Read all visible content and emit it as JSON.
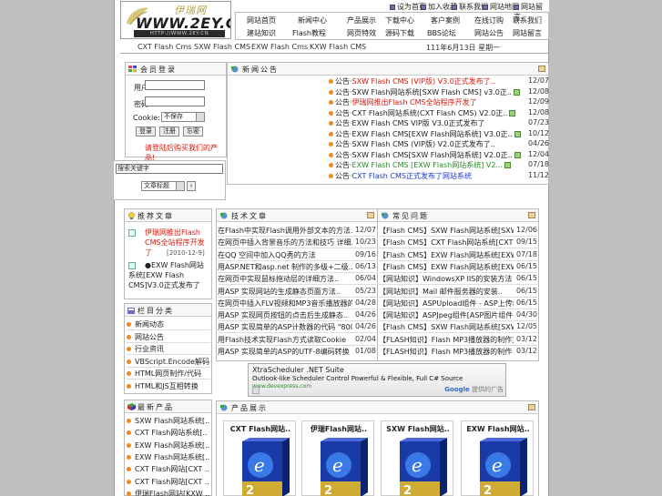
{
  "logo": {
    "cn": "伊瑞网",
    "domain": "WWW.2EY.CN",
    "url": "HTTP://WWW.2EY.CN"
  },
  "topbar": [
    "设为首页",
    "加入收藏",
    "联系我们",
    "网站地图",
    "网站留言"
  ],
  "nav": [
    [
      "网站首页",
      "新闻中心",
      "产品展示",
      "下载中心",
      "客户案例",
      "在线订购",
      "联系我们"
    ],
    [
      "建站知识",
      "Flash教程",
      "网页特效",
      "源码下载",
      "BBS论坛",
      "网站公告",
      "网站留言"
    ]
  ],
  "subnav": {
    "items": [
      "CXT Flash Cms",
      "SXW Flash CMS",
      "EXW Flash Cms",
      "KXW Flash CMS"
    ],
    "date": "111年6月13日 星期一"
  },
  "login": {
    "title": "会员登录",
    "user_label": "用户",
    "pass_label": "密码",
    "cookie_label": "Cookie:",
    "cookie_value": "不保存",
    "buttons": [
      "登录",
      "注册",
      "忘密"
    ],
    "notice": "请登陆后购买我们的产品!"
  },
  "search": {
    "value": "搜索关键字",
    "select": "文章标题"
  },
  "news": {
    "title": "新闻公告",
    "items": [
      {
        "prefix": "公告·",
        "text": "SXW Flash CMS (VIP版) V3.0正式发布了..",
        "date": "12/07",
        "red": true,
        "new": false
      },
      {
        "prefix": "公告·",
        "text": "SXW Flash网站系统[SXW Flash CMS] v3.0正..",
        "date": "12/08",
        "red": false,
        "new": true
      },
      {
        "prefix": "公告·",
        "text": "伊瑞网推出Flash CMS全站程序开发了",
        "date": "12/09",
        "red": true,
        "new": false
      },
      {
        "prefix": "公告·",
        "text": "CXT Flash网站系统(CXT Flash CMS) V2.0正..",
        "date": "12/08",
        "red": false,
        "new": true
      },
      {
        "prefix": "公告·",
        "text": "EXW Flash CMS VIP版 V3.0正式发布了",
        "date": "07/23",
        "red": false,
        "new": false
      },
      {
        "prefix": "公告·",
        "text": "EXW Flash CMS[EXW Flash网站系统] V3.0正..",
        "date": "10/12",
        "red": false,
        "new": true
      },
      {
        "prefix": "公告·",
        "text": "SXW Flash CMS (VIP版) V2.0正式发布了..",
        "date": "04/26",
        "red": false,
        "new": false
      },
      {
        "prefix": "公告·",
        "text": "SXW Flash CMS[SXW Flash网站系统] V2.0正..",
        "date": "12/04",
        "red": false,
        "new": true
      },
      {
        "prefix": "公告·",
        "text": "EXW Flash CMS [EXW Flash网站系统] V2...",
        "date": "07/18",
        "red": false,
        "green": true,
        "new": true
      },
      {
        "prefix": "公告·",
        "text": "CXT Flash CMS正式发布了网站系统",
        "date": "11/12",
        "red": false,
        "blue": true,
        "new": false
      }
    ]
  },
  "recommend": {
    "title": "推荐文章",
    "items": [
      {
        "text": "伊瑞网推出Flash CMS全站程序开发了",
        "date": "[2010-12-9]"
      },
      {
        "text": "●EXW Flash网站系统[EXW Flash CMS]V3.0正式发布了>>",
        "date": "[2010-10-12]"
      }
    ]
  },
  "categories": {
    "title": "栏目分类",
    "items": [
      "新闻动态",
      "网站公告",
      "行业资讯",
      "VBScript.Encode解码",
      "HTML网页制作/代码",
      "HTML和JS互相转换"
    ]
  },
  "tech": {
    "title": "技术文章",
    "items": [
      {
        "text": "在Flash中实现Flash调用外部文本的方法..",
        "date": "12/07"
      },
      {
        "text": "在网页中插入背景音乐的方法和技巧 详细..",
        "date": "10/23"
      },
      {
        "text": "在QQ 空间中加入QQ秀的方法",
        "date": "09/16"
      },
      {
        "text": "用ASP.NET和asp.net 制作的多级+二级..",
        "date": "06/13"
      },
      {
        "text": "在网页中实现鼠标拖动层的详细方法..",
        "date": "06/04"
      },
      {
        "text": "用ASP 实现网站的生成静态页面方法..",
        "date": "05/23"
      },
      {
        "text": "在网页中插入FLV视频和MP3音乐播放器的..",
        "date": "04/28"
      },
      {
        "text": "用ASP 实现网页按钮的点击后生成静态..",
        "date": "04/26"
      },
      {
        "text": "用ASP 实现简单的ASP计数器的代码 \"800..",
        "date": "04/26"
      },
      {
        "text": "用Flash技术实现Flash方式读取Cookie",
        "date": "02/04"
      },
      {
        "text": "用ASP 实现简单的ASP的UTF-8编码转换",
        "date": "01/08"
      }
    ]
  },
  "faq": {
    "title": "常见问题",
    "items": [
      {
        "text": "【Flash CMS】SXW Flash网站系统[SXW Fla..",
        "date": "12/06"
      },
      {
        "text": "【Flash CMS】CXT Flash网站系统[CXT Fla..",
        "date": "09/15"
      },
      {
        "text": "【Flash CMS】EXW Flash网站系统[EXW Fla..",
        "date": "07/18"
      },
      {
        "text": "【Flash CMS】EXW Flash网站系统[EXW Fla..",
        "date": "06/15"
      },
      {
        "text": "【网站知识】WindowsXP IIS的安装方法 +..",
        "date": "06/15"
      },
      {
        "text": "【网站知识】Mail 邮件服务器的安装..",
        "date": "06/15"
      },
      {
        "text": "【网站知识】ASPUpload组件 - ASP上传组..",
        "date": "06/15"
      },
      {
        "text": "【网站知识】ASPJpeg组件[ASP图片组件]..",
        "date": "04/30"
      },
      {
        "text": "【Flash CMS】SXW Flash网站系统[SXW Fla..",
        "date": "12/05"
      },
      {
        "text": "【FLASH知识】Flash MP3播放器的制作方法..",
        "date": "03/12"
      },
      {
        "text": "【FLASH知识】Flash MP3播放器的制作",
        "date": "03/12"
      }
    ]
  },
  "ad": {
    "title": "XtraScheduler .NET Suite",
    "line": "Outlook-like Scheduler Control Powerful & Flexible, Full C# Source",
    "link": "www.devexpress.com",
    "gads_a": "Google",
    "gads_b": " 提供的广告"
  },
  "products_section": {
    "title": "产品展示"
  },
  "products": [
    "CXT Flash网站..",
    "伊瑞Flash网站..",
    "SXW Flash网站..",
    "EXW Flash网站.."
  ],
  "new_products": {
    "title": "最新产品",
    "items": [
      "SXW Flash网站系统[..",
      "CXT Flash网站系统[..",
      "EXW Flash网站系统[..",
      "EXW Flash网站系统[..",
      "CXT Flash网站[CXT ..",
      "CXT Flash网站[CXT ..",
      "伊瑞Flash网站[KXW .."
    ]
  },
  "colors": {
    "accent_red": "#d8180c",
    "bullet": "#f08a1c",
    "border": "#bbbbbb"
  }
}
